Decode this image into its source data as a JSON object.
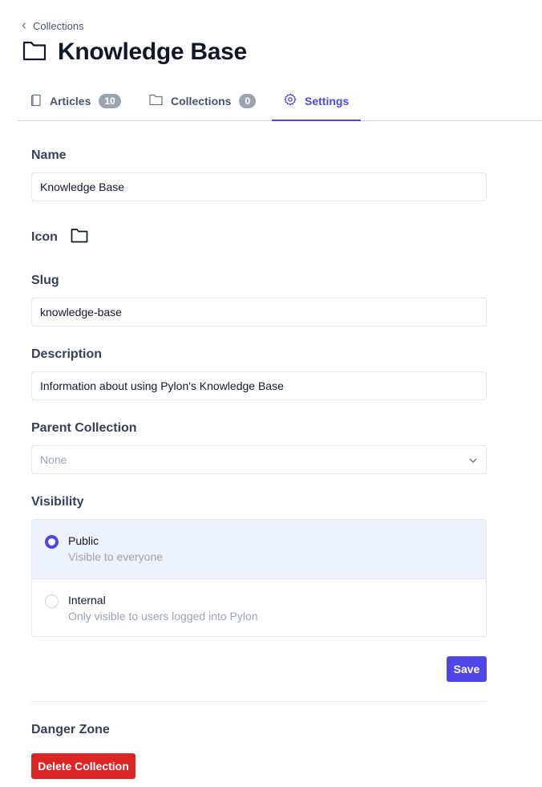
{
  "breadcrumb": {
    "label": "Collections"
  },
  "page": {
    "title": "Knowledge Base",
    "icon": "folder-icon"
  },
  "tabs": [
    {
      "label": "Articles",
      "count": "10",
      "icon": "article-icon"
    },
    {
      "label": "Collections",
      "count": "0",
      "icon": "folder-icon"
    },
    {
      "label": "Settings",
      "icon": "gear-icon",
      "active": true
    }
  ],
  "form": {
    "name_label": "Name",
    "name_value": "Knowledge Base",
    "icon_label": "Icon",
    "icon_value": "folder-icon",
    "slug_label": "Slug",
    "slug_value": "knowledge-base",
    "description_label": "Description",
    "description_value": "Information about using Pylon's Knowledge Base",
    "parent_label": "Parent Collection",
    "parent_value": "None",
    "visibility_label": "Visibility",
    "visibility_options": [
      {
        "title": "Public",
        "subtitle": "Visible to everyone",
        "selected": true
      },
      {
        "title": "Internal",
        "subtitle": "Only visible to users logged into Pylon",
        "selected": false
      }
    ],
    "save_label": "Save"
  },
  "danger": {
    "title": "Danger Zone",
    "delete_label": "Delete Collection"
  },
  "colors": {
    "accent": "#4f46e5",
    "danger": "#dc2626",
    "selected_bg": "#eef2ff"
  }
}
